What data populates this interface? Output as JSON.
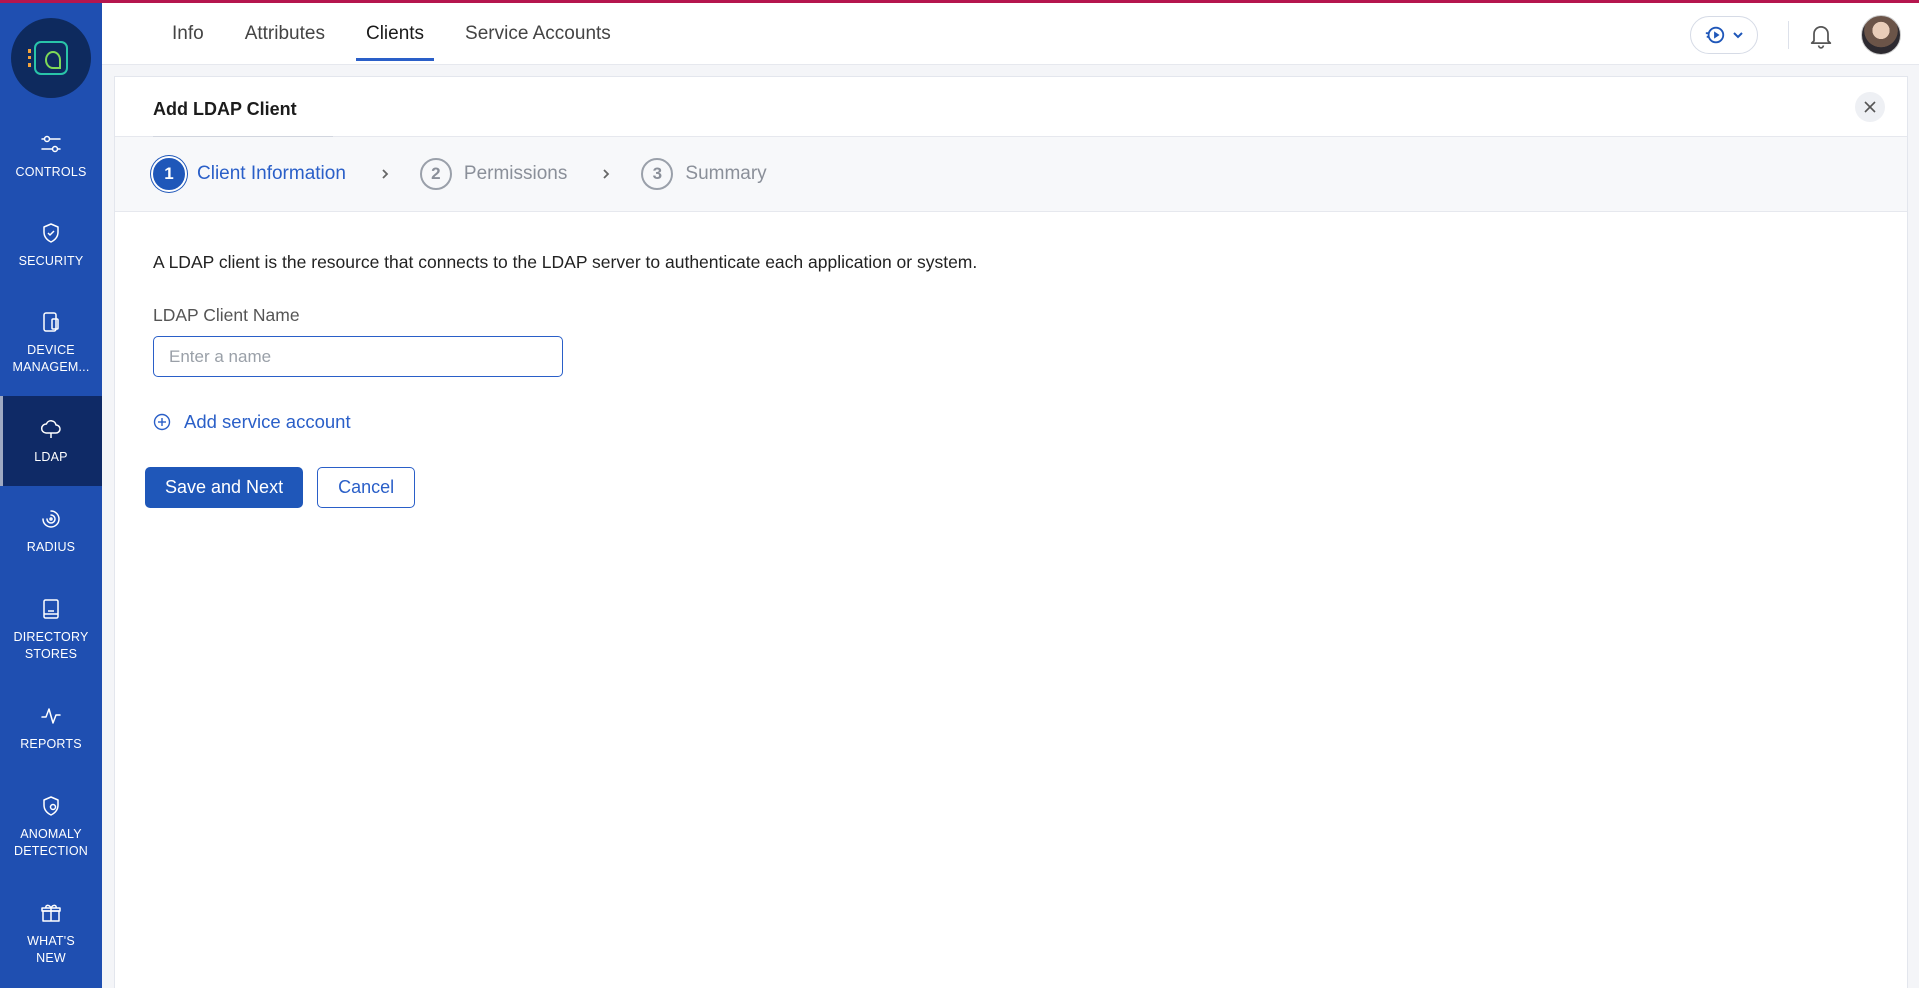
{
  "sidebar": {
    "items": [
      {
        "id": "controls",
        "label": "CONTROLS",
        "icon": "sliders-icon"
      },
      {
        "id": "security",
        "label": "SECURITY",
        "icon": "shield-icon"
      },
      {
        "id": "device",
        "label": "DEVICE\nMANAGEM...",
        "icon": "device-icon"
      },
      {
        "id": "ldap",
        "label": "LDAP",
        "icon": "cloud-icon",
        "active": true
      },
      {
        "id": "radius",
        "label": "RADIUS",
        "icon": "radius-icon"
      },
      {
        "id": "directory",
        "label": "DIRECTORY\nSTORES",
        "icon": "directory-icon"
      },
      {
        "id": "reports",
        "label": "REPORTS",
        "icon": "pulse-icon"
      },
      {
        "id": "anomaly",
        "label": "ANOMALY\nDETECTION",
        "icon": "shield-gear-icon"
      },
      {
        "id": "whatsnew",
        "label": "WHAT'S\nNEW",
        "icon": "gift-icon"
      }
    ]
  },
  "header": {
    "tabs": [
      "Info",
      "Attributes",
      "Clients",
      "Service Accounts"
    ],
    "active_tab": "Clients"
  },
  "panel": {
    "title": "Add LDAP Client",
    "steps": [
      {
        "num": "1",
        "label": "Client Information",
        "active": true
      },
      {
        "num": "2",
        "label": "Permissions"
      },
      {
        "num": "3",
        "label": "Summary"
      }
    ],
    "description": "A LDAP client is the resource that connects to the LDAP server to authenticate each application or system.",
    "field_label": "LDAP Client Name",
    "field_value": "",
    "field_placeholder": "Enter a name",
    "add_service_account": "Add service account",
    "save_label": "Save and Next",
    "cancel_label": "Cancel"
  },
  "colors": {
    "sidebar": "#1f4fb1",
    "sidebar_active": "#0f2a66",
    "accent": "#2a5fc8",
    "top_accent": "#b5164e"
  }
}
